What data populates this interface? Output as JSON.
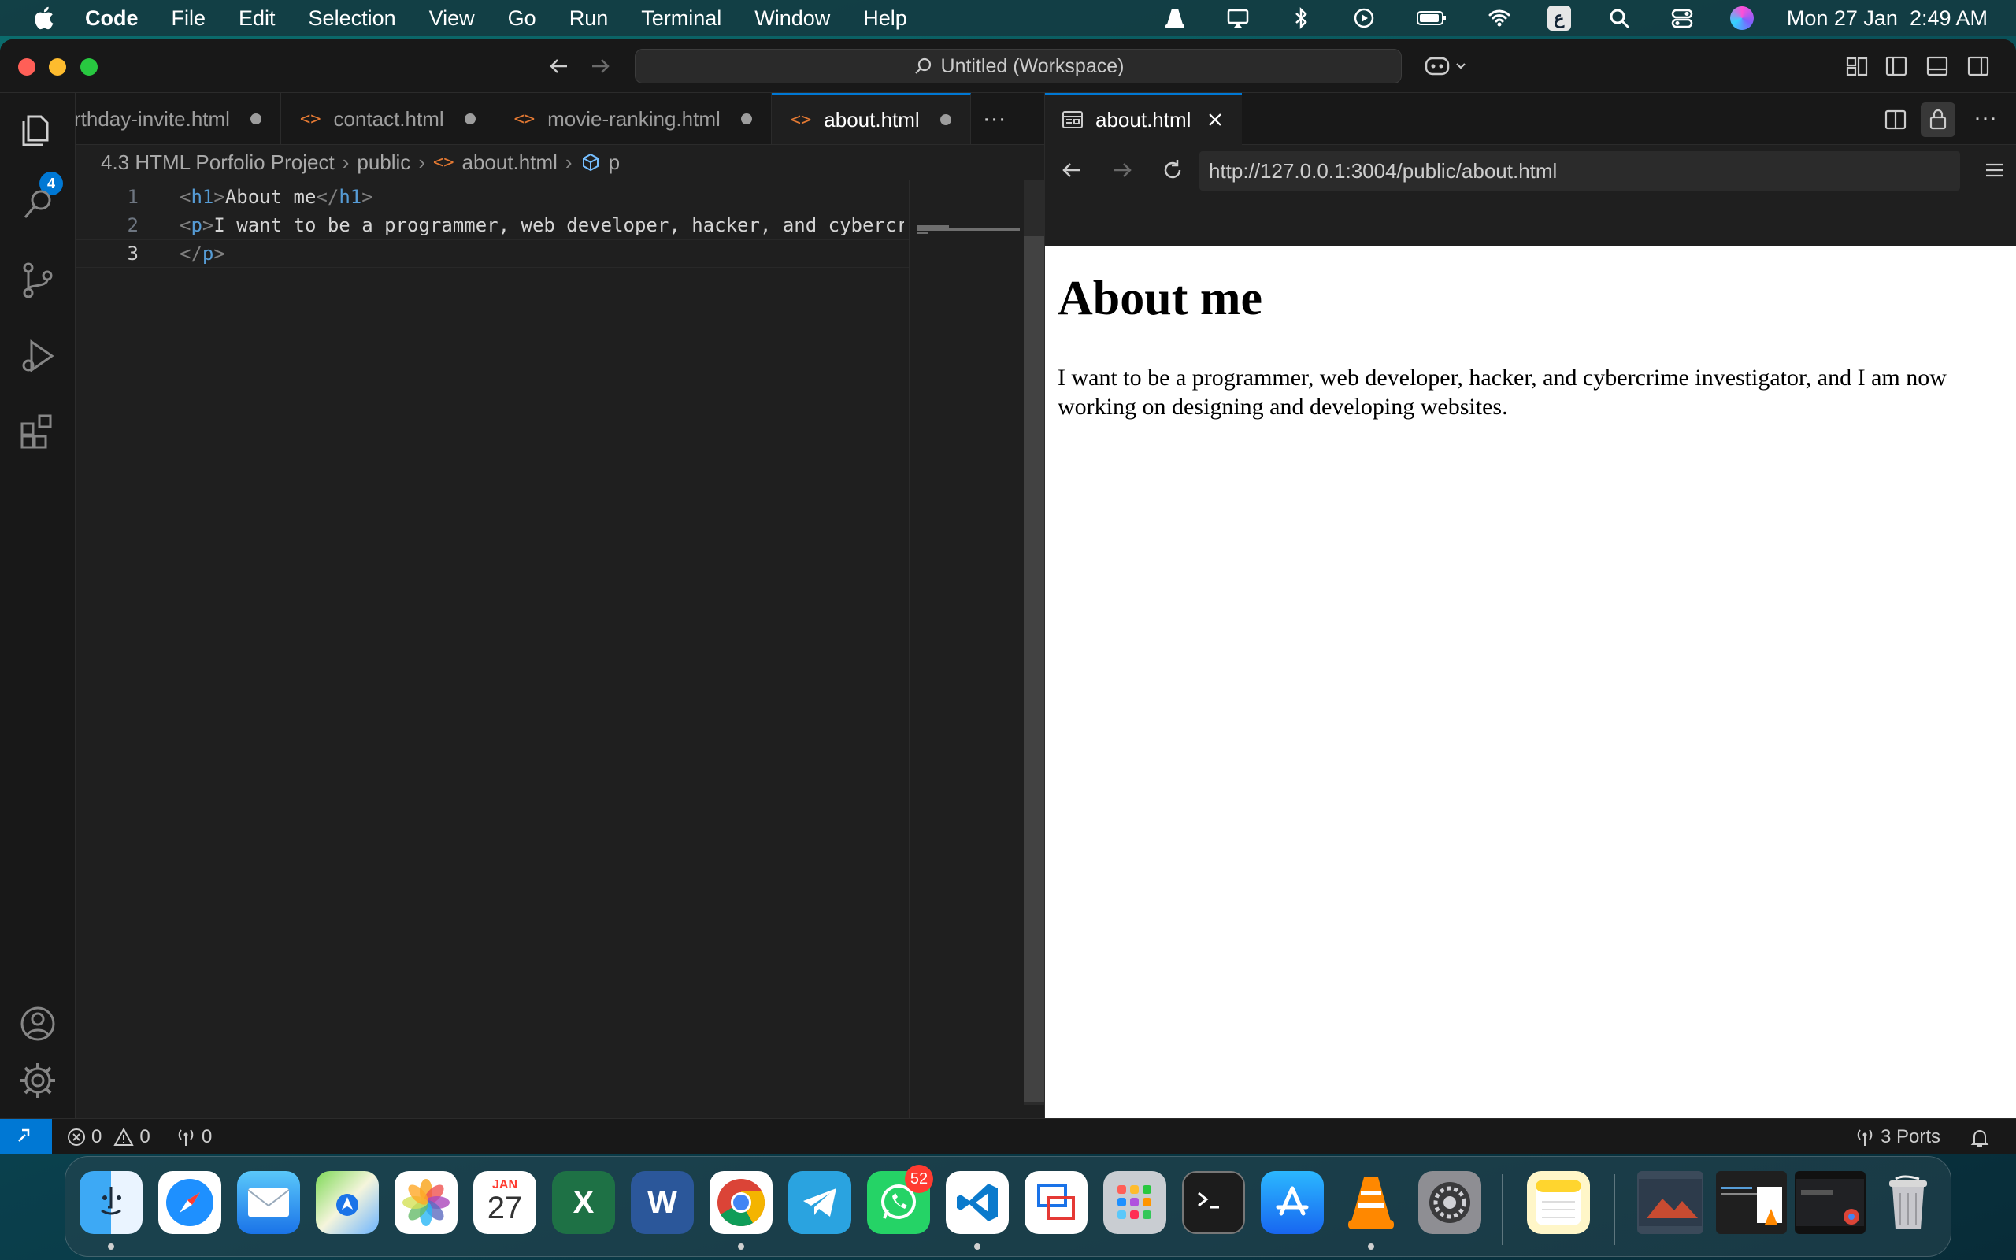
{
  "menubar": {
    "app_name": "Code",
    "items": [
      "File",
      "Edit",
      "Selection",
      "View",
      "Go",
      "Run",
      "Terminal",
      "Window",
      "Help"
    ],
    "ime_label": "ع",
    "clock": "Mon 27 Jan  2:49 AM"
  },
  "titlebar": {
    "command_center": "Untitled (Workspace)"
  },
  "activitybar": {
    "explorer_badge": "4"
  },
  "editor": {
    "tabs": [
      {
        "label": "rthday-invite.html"
      },
      {
        "label": "contact.html"
      },
      {
        "label": "movie-ranking.html"
      },
      {
        "label": "about.html"
      }
    ],
    "more_label": "···",
    "breadcrumb": [
      "4.3 HTML Porfolio Project",
      "public",
      "about.html",
      "p"
    ],
    "lines": [
      {
        "num": "1",
        "open_tag": "h1",
        "text": "About me",
        "close_tag": "h1"
      },
      {
        "num": "2",
        "open_tag": "p",
        "text": "I want to be a programmer, web developer, hacker, and cybercr"
      },
      {
        "num": "3",
        "close_tag": "p"
      }
    ]
  },
  "browser": {
    "tab_label": "about.html",
    "url": "http://127.0.0.1:3004/public/about.html",
    "page_heading": "About me",
    "page_paragraph": "I want to be a programmer, web developer, hacker, and cybercrime investigator, and I am now working on designing and developing websites."
  },
  "statusbar": {
    "errors": "0",
    "warnings": "0",
    "ports_forwarded": "0",
    "ports_label": "3 Ports"
  },
  "dock": {
    "calendar_month": "JAN",
    "calendar_day": "27",
    "whatsapp_badge": "52"
  },
  "colors": {
    "accent": "#0078d4",
    "html_icon": "#e37933",
    "tag_name": "#569cd6"
  }
}
